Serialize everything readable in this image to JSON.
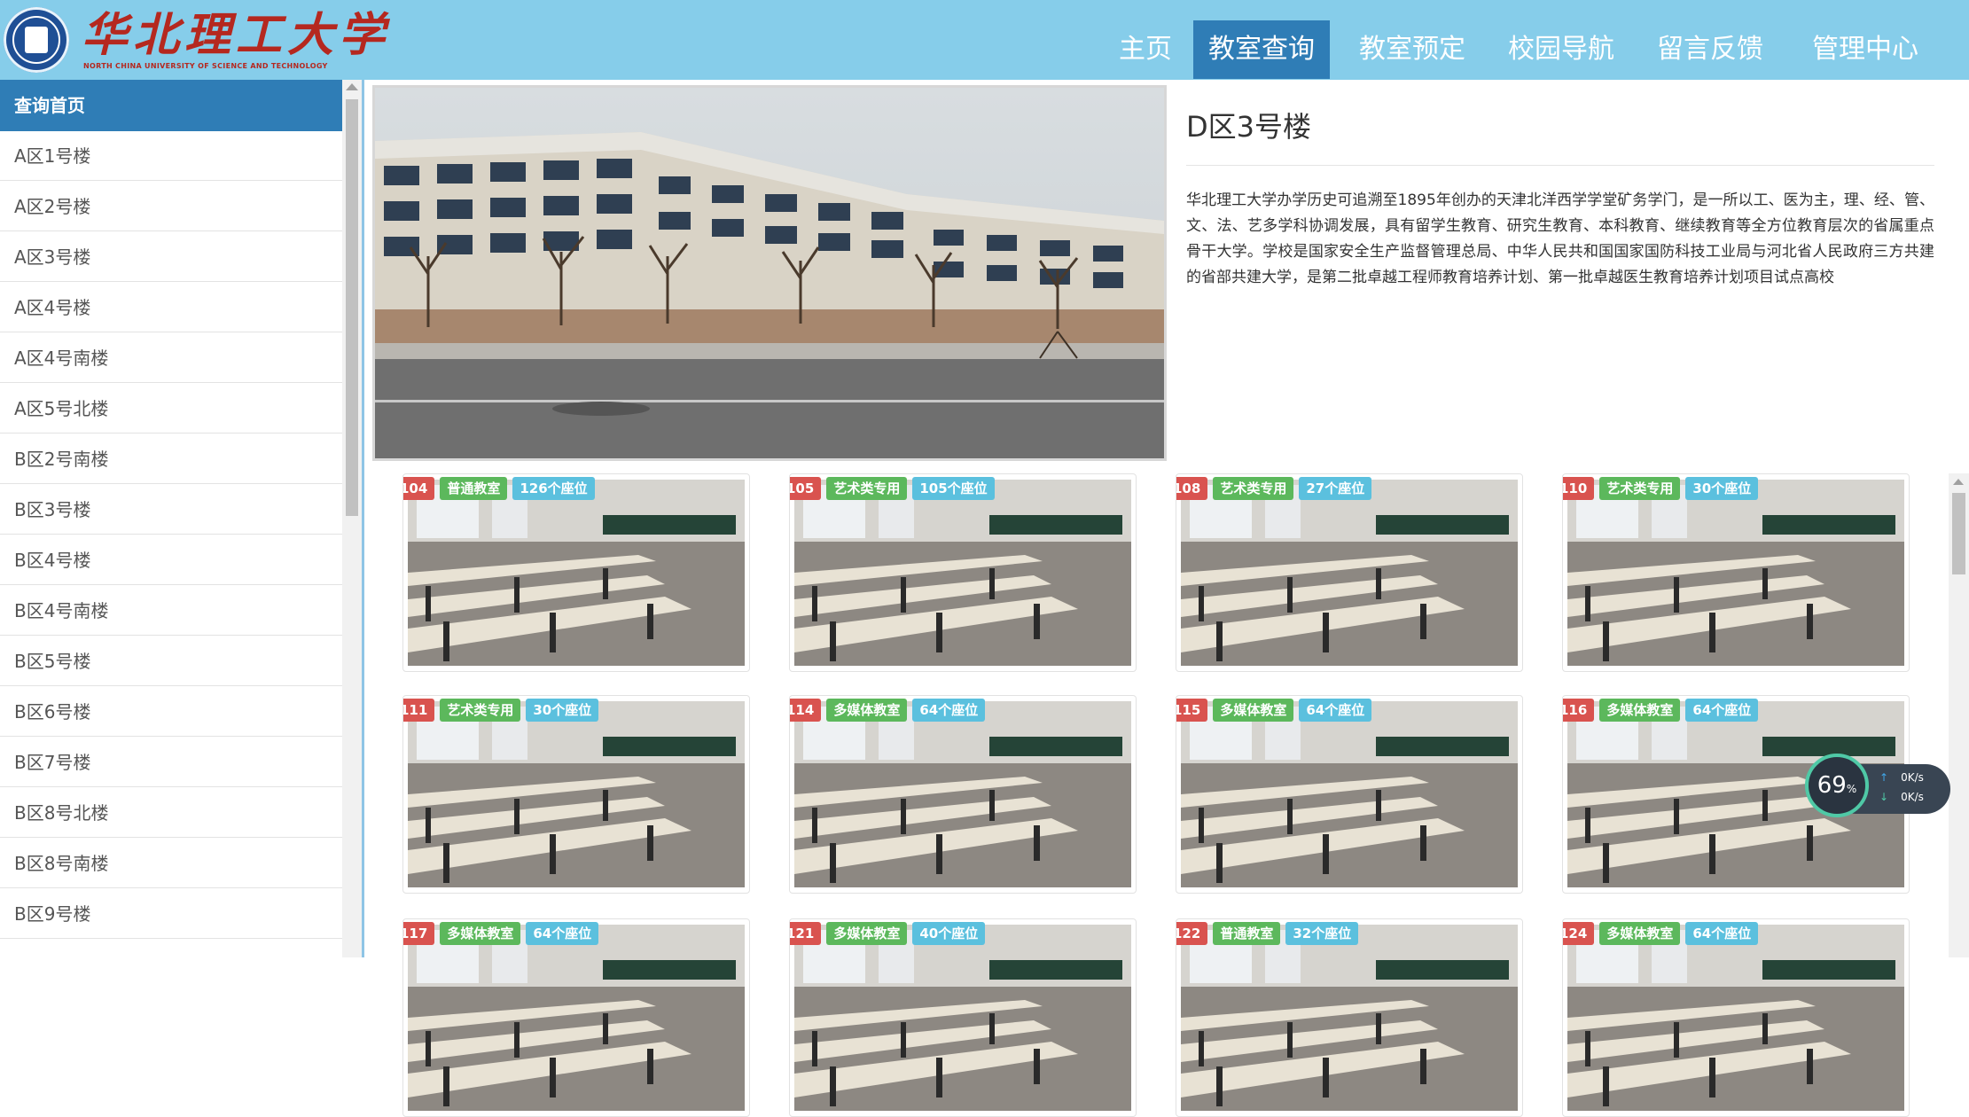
{
  "header": {
    "logo_cn": "华北理工大学",
    "logo_en": "NORTH CHINA UNIVERSITY OF SCIENCE AND TECHNOLOGY",
    "nav": [
      "主页",
      "教室查询",
      "教室预定",
      "校园导航",
      "留言反馈",
      "管理中心"
    ],
    "active_nav": "教室查询"
  },
  "sidebar": {
    "items": [
      "查询首页",
      "A区1号楼",
      "A区2号楼",
      "A区3号楼",
      "A区4号楼",
      "A区4号南楼",
      "A区5号北楼",
      "B区2号南楼",
      "B区3号楼",
      "B区4号楼",
      "B区4号南楼",
      "B区5号楼",
      "B区6号楼",
      "B区7号楼",
      "B区8号北楼",
      "B区8号南楼",
      "B区9号楼"
    ],
    "active": "查询首页"
  },
  "building": {
    "title": "D区3号楼",
    "description": "华北理工大学办学历史可追溯至1895年创办的天津北洋西学学堂矿务学门，是一所以工、医为主，理、经、管、文、法、艺多学科协调发展，具有留学生教育、研究生教育、本科教育、继续教育等全方位教育层次的省属重点骨干大学。学校是国家安全生产监督管理总局、中华人民共和国国家国防科技工业局与河北省人民政府三方共建的省部共建大学，是第二批卓越工程师教育培养计划、第一批卓越医生教育培养计划项目试点高校"
  },
  "rooms": [
    {
      "number": "104",
      "type": "普通教室",
      "seats": "126个座位"
    },
    {
      "number": "105",
      "type": "艺术类专用",
      "seats": "105个座位"
    },
    {
      "number": "108",
      "type": "艺术类专用",
      "seats": "27个座位"
    },
    {
      "number": "110",
      "type": "艺术类专用",
      "seats": "30个座位"
    },
    {
      "number": "111",
      "type": "艺术类专用",
      "seats": "30个座位"
    },
    {
      "number": "114",
      "type": "多媒体教室",
      "seats": "64个座位"
    },
    {
      "number": "115",
      "type": "多媒体教室",
      "seats": "64个座位"
    },
    {
      "number": "116",
      "type": "多媒体教室",
      "seats": "64个座位"
    },
    {
      "number": "117",
      "type": "多媒体教室",
      "seats": "64个座位"
    },
    {
      "number": "121",
      "type": "多媒体教室",
      "seats": "40个座位"
    },
    {
      "number": "122",
      "type": "普通教室",
      "seats": "32个座位"
    },
    {
      "number": "124",
      "type": "多媒体教室",
      "seats": "64个座位"
    }
  ],
  "speed_widget": {
    "percent": "69",
    "percent_unit": "%",
    "upload": "0K/s",
    "download": "0K/s"
  },
  "colors": {
    "header_bg": "#86cdea",
    "nav_active": "#2f7db6",
    "tag_number": "#d9534f",
    "tag_type": "#5cb85c",
    "tag_seats": "#5bc0de"
  }
}
